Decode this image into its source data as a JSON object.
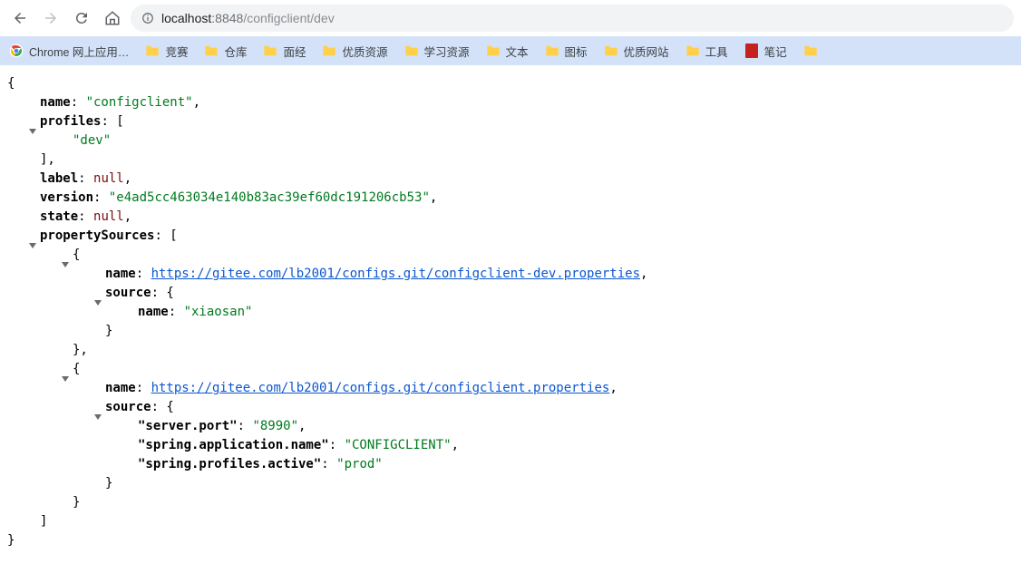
{
  "url": {
    "host": "localhost",
    "port": ":8848",
    "path": "/configclient/dev"
  },
  "bookmarks": [
    {
      "kind": "chrome",
      "label": "Chrome 网上应用…"
    },
    {
      "kind": "folder",
      "label": "竞赛"
    },
    {
      "kind": "folder",
      "label": "仓库"
    },
    {
      "kind": "folder",
      "label": "面经"
    },
    {
      "kind": "folder",
      "label": "优质资源"
    },
    {
      "kind": "folder",
      "label": "学习资源"
    },
    {
      "kind": "folder",
      "label": "文本"
    },
    {
      "kind": "folder",
      "label": "图标"
    },
    {
      "kind": "folder",
      "label": "优质网站"
    },
    {
      "kind": "folder",
      "label": "工具"
    },
    {
      "kind": "book",
      "label": "笔记"
    },
    {
      "kind": "folder",
      "label": ""
    }
  ],
  "json": {
    "name_key": "name",
    "name_val": "\"configclient\"",
    "profiles_key": "profiles",
    "profiles_item": "\"dev\"",
    "label_key": "label",
    "label_val": "null",
    "version_key": "version",
    "version_val": "\"e4ad5cc463034e140b83ac39ef60dc191206cb53\"",
    "state_key": "state",
    "state_val": "null",
    "ps_key": "propertySources",
    "ps": [
      {
        "name_key": "name",
        "name_url": "https://gitee.com/lb2001/configs.git/configclient-dev.properties",
        "source_key": "source",
        "inner_name_key": "name",
        "inner_name_val": "\"xiaosan\""
      },
      {
        "name_key": "name",
        "name_url": "https://gitee.com/lb2001/configs.git/configclient.properties",
        "source_key": "source",
        "port_key": "\"server.port\"",
        "port_val": "\"8990\"",
        "app_key": "\"spring.application.name\"",
        "app_val": "\"CONFIGCLIENT\"",
        "prof_key": "\"spring.profiles.active\"",
        "prof_val": "\"prod\""
      }
    ]
  }
}
